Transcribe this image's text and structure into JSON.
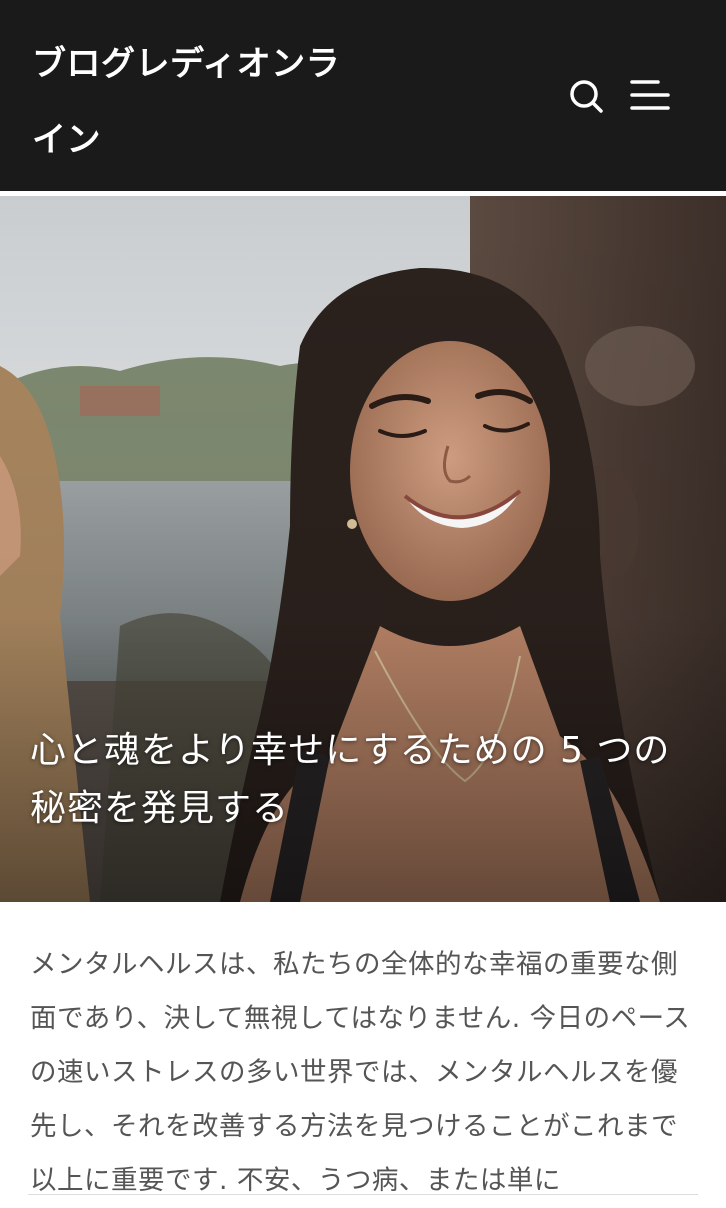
{
  "header": {
    "site_title": "ブログレディオンライン",
    "search_icon": "search-icon",
    "menu_icon": "menu-icon",
    "background": "#1a1a1a"
  },
  "hero": {
    "title": "心と魂をより幸せにするための 5 つの秘密を発見する",
    "image_description": "smiling-woman-photo"
  },
  "article": {
    "intro": "メンタルヘルスは、私たちの全体的な幸福の重要な側面であり、決して無視してはなりません. 今日のペースの速いストレスの多い世界では、メンタルヘルスを優先し、それを改善する方法を見つけることがこれまで以上に重要です. 不安、うつ病、または単に"
  },
  "colors": {
    "header_bg": "#1a1a1a",
    "header_text": "#ffffff",
    "body_text": "#555555"
  }
}
